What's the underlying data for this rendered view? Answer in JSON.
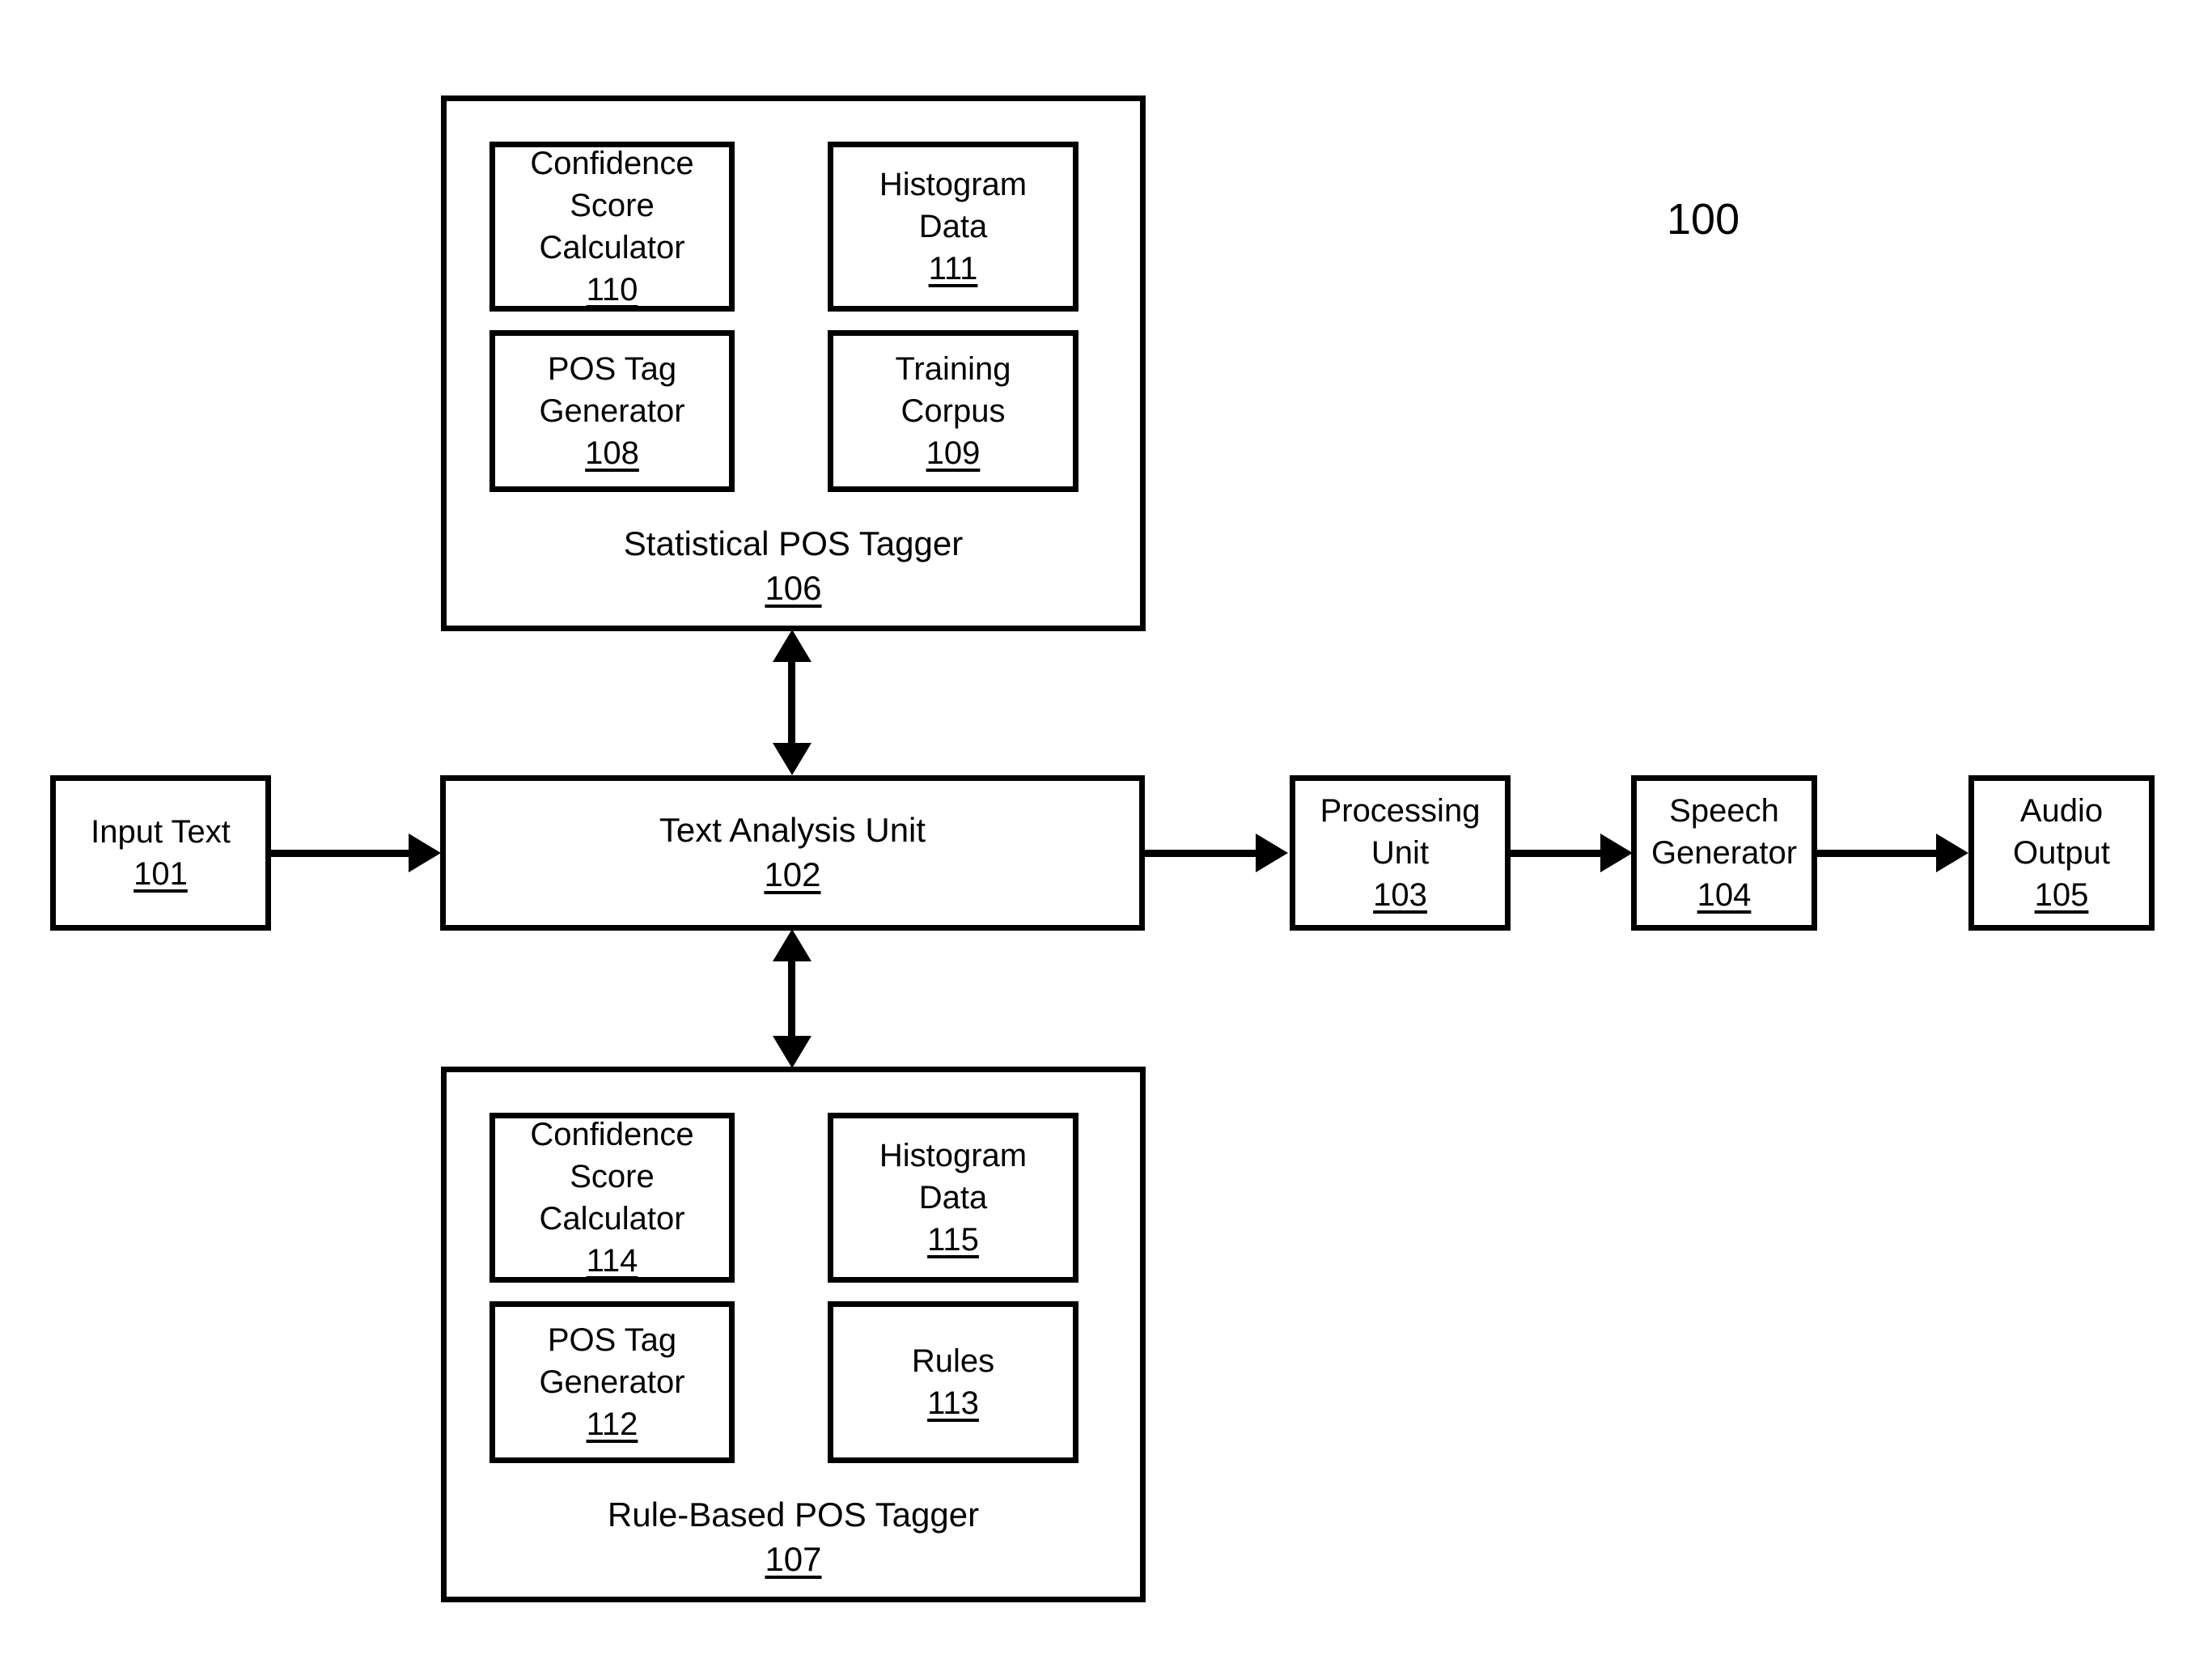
{
  "figure": {
    "reference_number": "100"
  },
  "statistical_tagger": {
    "title": "Statistical POS Tagger",
    "number": "106",
    "components": [
      {
        "label": "Confidence\nScore\nCalculator",
        "number": "110"
      },
      {
        "label": "Histogram\nData",
        "number": "111"
      },
      {
        "label": "POS Tag\nGenerator",
        "number": "108"
      },
      {
        "label": "Training\nCorpus",
        "number": "109"
      }
    ]
  },
  "rule_tagger": {
    "title": "Rule-Based POS Tagger",
    "number": "107",
    "components": [
      {
        "label": "Confidence\nScore\nCalculator",
        "number": "114"
      },
      {
        "label": "Histogram\nData",
        "number": "115"
      },
      {
        "label": "POS Tag\nGenerator",
        "number": "112"
      },
      {
        "label": "Rules",
        "number": "113"
      }
    ]
  },
  "pipeline": [
    {
      "label": "Input Text",
      "number": "101"
    },
    {
      "label": "Text Analysis Unit",
      "number": "102"
    },
    {
      "label": "Processing\nUnit",
      "number": "103"
    },
    {
      "label": "Speech\nGenerator",
      "number": "104"
    },
    {
      "label": "Audio\nOutput",
      "number": "105"
    }
  ]
}
